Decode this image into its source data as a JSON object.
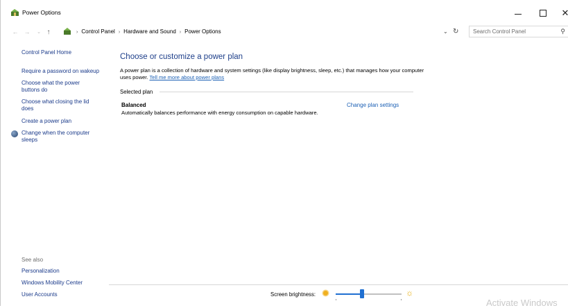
{
  "window": {
    "title": "Power Options"
  },
  "address": {
    "breadcrumbs": [
      "Control Panel",
      "Hardware and Sound",
      "Power Options"
    ]
  },
  "search": {
    "placeholder": "Search Control Panel"
  },
  "sidebar": {
    "home": "Control Panel Home",
    "items": [
      {
        "label": "Require a password on wakeup"
      },
      {
        "label": "Choose what the power buttons do"
      },
      {
        "label": "Choose what closing the lid does"
      },
      {
        "label": "Create a power plan"
      },
      {
        "label": "Change when the computer sleeps"
      }
    ],
    "see_also": {
      "heading": "See also",
      "links": [
        "Personalization",
        "Windows Mobility Center",
        "User Accounts"
      ]
    }
  },
  "main": {
    "title": "Choose or customize a power plan",
    "description": "A power plan is a collection of hardware and system settings (like display brightness, sleep, etc.) that manages how your computer uses power.",
    "description_link": "Tell me more about power plans",
    "selected_plan_label": "Selected plan",
    "plan": {
      "name": "Balanced",
      "description": "Automatically balances performance with energy consumption on capable hardware.",
      "change_link": "Change plan settings"
    }
  },
  "bottom": {
    "brightness_label": "Screen brightness:",
    "brightness_value": 0.4
  },
  "watermark": "Activate Windows",
  "colors": {
    "link": "#1a5fb4",
    "title": "#1e3f8a",
    "slider": "#1f6fd1"
  }
}
